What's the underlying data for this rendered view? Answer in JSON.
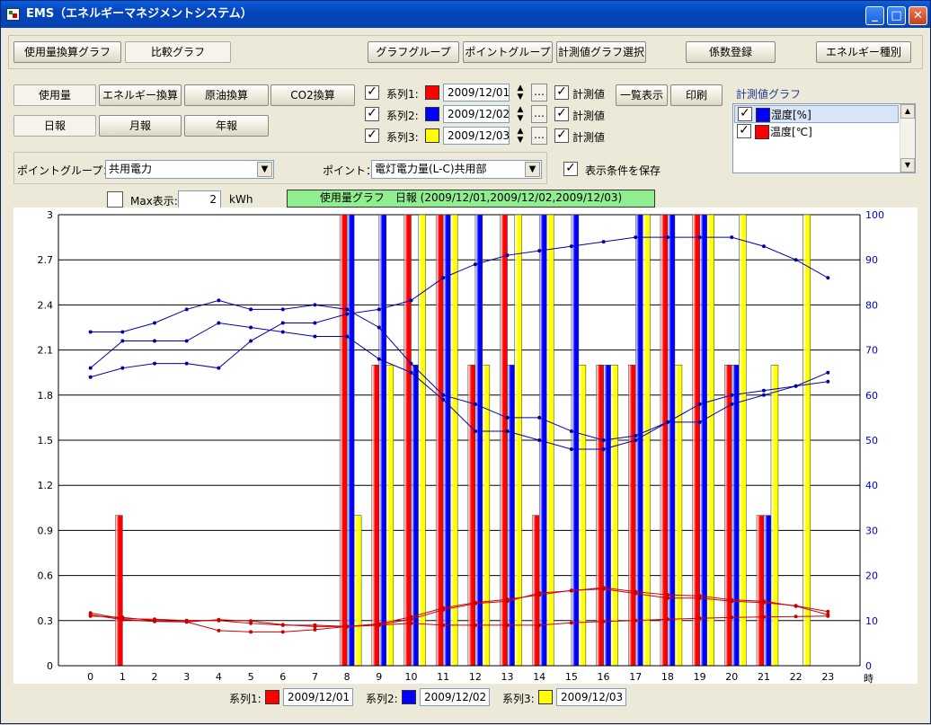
{
  "window": {
    "title": "EMS（エネルギーマネジメントシステム）"
  },
  "top_tabs": [
    "使用量換算グラフ",
    "比較グラフ"
  ],
  "top_buttons": [
    "グラフグループ",
    "ポイントグループ",
    "計測値グラフ選択",
    "係数登録",
    "エネルギー種別"
  ],
  "mode_buttons": [
    "使用量",
    "エネルギー換算",
    "原油換算",
    "CO2換算"
  ],
  "period_buttons": [
    "日報",
    "月報",
    "年報"
  ],
  "series_rows": [
    {
      "label": "系列1:",
      "color": "#ff0000",
      "date": "2009/12/01",
      "meas_label": "計測値"
    },
    {
      "label": "系列2:",
      "color": "#0000ff",
      "date": "2009/12/02",
      "meas_label": "計測値"
    },
    {
      "label": "系列3:",
      "color": "#ffff00",
      "date": "2009/12/03",
      "meas_label": "計測値"
    }
  ],
  "list_button": "一覧表示",
  "print_button": "印刷",
  "meas_graph": {
    "title": "計測値グラフ",
    "items": [
      {
        "label": "湿度[%]",
        "color": "#0000ff",
        "selected": true
      },
      {
        "label": "温度[℃]",
        "color": "#ff0000",
        "selected": false
      }
    ]
  },
  "point_group": {
    "label": "ポイントグループ：",
    "value": "共用電力"
  },
  "point": {
    "label": "ポイント：",
    "value": "電灯電力量(L-C)共用部"
  },
  "save_condition": "表示条件を保存",
  "max_display": {
    "label": "Max表示:",
    "value": "2",
    "unit": "kWh"
  },
  "chart_header": "使用量グラフ　日報 (2009/12/01,2009/12/02,2009/12/03)",
  "legend": [
    {
      "label": "系列1:",
      "color": "#ff0000",
      "date": "2009/12/01"
    },
    {
      "label": "系列2:",
      "color": "#0000ff",
      "date": "2009/12/02"
    },
    {
      "label": "系列3:",
      "color": "#ffff00",
      "date": "2009/12/03"
    }
  ],
  "chart_data": {
    "type": "bar",
    "x": [
      0,
      1,
      2,
      3,
      4,
      5,
      6,
      7,
      8,
      9,
      10,
      11,
      12,
      13,
      14,
      15,
      16,
      17,
      18,
      19,
      20,
      21,
      22,
      23
    ],
    "xlabel": "時",
    "ylim": [
      0,
      3
    ],
    "y_ticks": [
      "0",
      "0.3",
      "0.6",
      "0.9",
      "1.2",
      "1.5",
      "1.8",
      "2.1",
      "2.4",
      "2.7",
      "3"
    ],
    "y2lim": [
      0,
      100
    ],
    "y2_ticks": [
      "0",
      "10",
      "20",
      "30",
      "40",
      "50",
      "60",
      "70",
      "80",
      "90",
      "100"
    ],
    "grid": true,
    "bar_series": [
      {
        "name": "系列1:",
        "color": "#ff0000",
        "values": [
          0,
          1,
          0,
          0,
          0,
          0,
          0,
          0,
          3,
          2,
          3,
          3,
          2,
          3,
          1,
          0,
          2,
          2,
          3,
          3,
          2,
          1,
          0,
          0
        ]
      },
      {
        "name": "系列2:",
        "color": "#0000ff",
        "values": [
          0,
          0,
          0,
          0,
          0,
          0,
          0,
          0,
          3,
          3,
          2,
          3,
          3,
          2,
          3,
          3,
          2,
          3,
          3,
          3,
          2,
          1,
          0,
          0
        ]
      },
      {
        "name": "系列3:",
        "color": "#ffff00",
        "values": [
          0,
          0,
          0,
          0,
          0,
          0,
          0,
          0,
          1,
          2,
          3,
          3,
          2,
          3,
          3,
          2,
          2,
          3,
          2,
          3,
          3,
          2,
          3,
          0
        ]
      }
    ],
    "line_series": [
      {
        "axis": "right",
        "color": "#0000aa",
        "values": [
          74,
          74,
          76,
          79,
          81,
          79,
          79,
          80,
          79,
          75,
          67,
          60,
          58,
          55,
          55,
          52,
          50,
          51,
          54,
          58,
          60,
          61,
          62,
          65
        ]
      },
      {
        "axis": "right",
        "color": "#0000aa",
        "values": [
          66,
          72,
          72,
          72,
          76,
          75,
          74,
          73,
          73,
          68,
          65,
          59,
          52,
          52,
          50,
          48,
          48,
          50,
          54,
          54,
          58,
          60,
          62,
          63
        ]
      },
      {
        "axis": "right",
        "color": "#0000aa",
        "values": [
          64,
          66,
          67,
          67,
          66,
          72,
          76,
          76,
          78,
          79,
          81,
          86,
          89,
          91,
          92,
          93,
          94,
          95,
          95,
          95,
          95,
          93,
          90,
          86
        ]
      },
      {
        "axis": "right",
        "color": "#cc0000",
        "values": [
          11.7,
          10.4,
          10.3,
          10.0,
          10.0,
          9.4,
          9.0,
          9.0,
          8.7,
          9.3,
          10.8,
          12.8,
          14.0,
          14.7,
          15.7,
          16.7,
          17.0,
          16.0,
          15.0,
          15.0,
          14.3,
          14.0,
          13.3,
          12.0
        ]
      },
      {
        "axis": "right",
        "color": "#cc0000",
        "values": [
          11.0,
          10.7,
          10.0,
          9.7,
          10.2,
          9.9,
          9.1,
          8.7,
          8.7,
          9.1,
          10.3,
          12.4,
          13.8,
          14.3,
          16.1,
          16.6,
          17.3,
          16.4,
          15.7,
          15.5,
          14.6,
          14.3,
          13.2,
          11.3
        ]
      },
      {
        "axis": "right",
        "color": "#cc0000",
        "values": [
          11.3,
          10.2,
          9.8,
          9.7,
          7.8,
          7.5,
          7.5,
          8.0,
          8.7,
          9.0,
          9.4,
          9.0,
          9.0,
          9.0,
          9.0,
          9.5,
          9.8,
          10.0,
          10.3,
          10.5,
          10.7,
          10.8,
          10.9,
          11.0
        ]
      }
    ]
  }
}
